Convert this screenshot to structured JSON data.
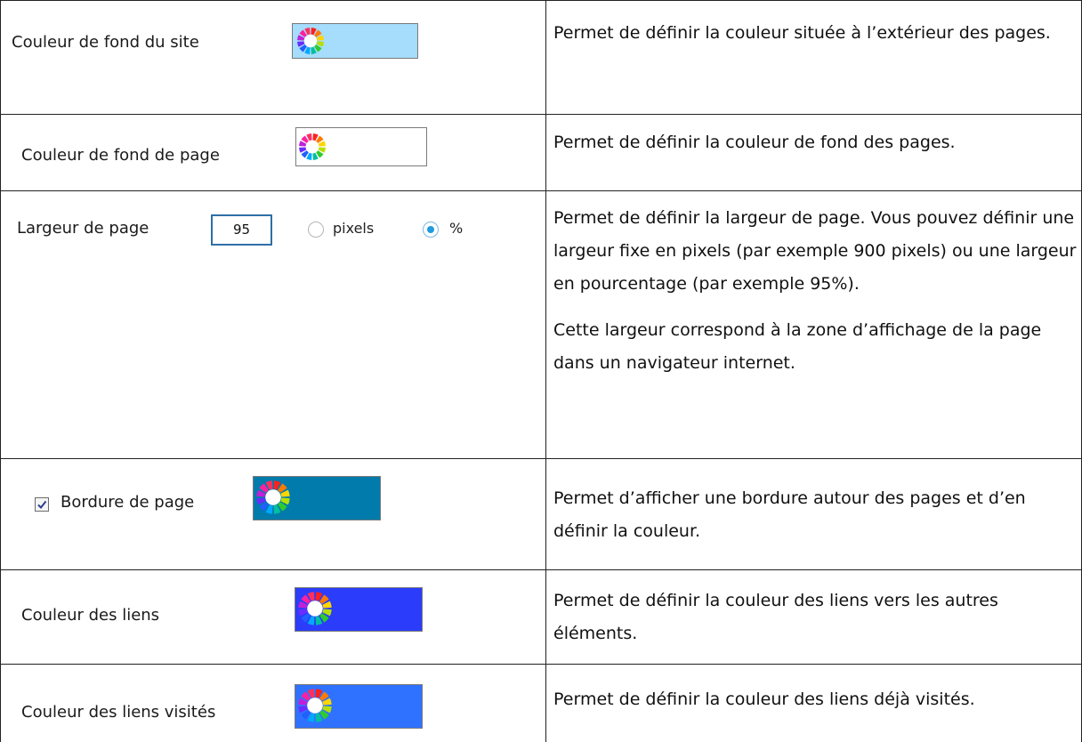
{
  "rows": [
    {
      "label": "Couleur de fond du site",
      "swatch_color": "#a6dcfc",
      "description": "Permet de définir la couleur située à l’extérieur des pages."
    },
    {
      "label": "Couleur de fond de page",
      "swatch_color": "#ffffff",
      "description": "Permet de définir la couleur de fond des pages."
    },
    {
      "label": "Largeur de page",
      "width_value": "95",
      "option_pixels": "pixels",
      "option_percent": "%",
      "selected_unit": "%",
      "description_p1": "Permet de définir la largeur de page. Vous pouvez définir une largeur fixe en pixels (par exemple 900 pixels) ou une largeur en pourcentage (par exemple 95%).",
      "description_p2": "Cette largeur correspond à la zone d’affichage de la page dans un navigateur internet."
    },
    {
      "label": "Bordure de page",
      "checked": true,
      "swatch_color": "#007bab",
      "description": "Permet d’afficher une bordure autour des pages et d’en définir la couleur."
    },
    {
      "label": "Couleur des liens",
      "swatch_color": "#2b3cfb",
      "description": "Permet de définir la couleur des liens vers les autres éléments."
    },
    {
      "label": "Couleur des liens visités",
      "swatch_color": "#2f72ff",
      "description": "Permet de définir la couleur des liens déjà visités."
    }
  ],
  "icons": {
    "color_picker": "color-wheel-icon",
    "checkbox_mark": "checkmark-icon"
  }
}
